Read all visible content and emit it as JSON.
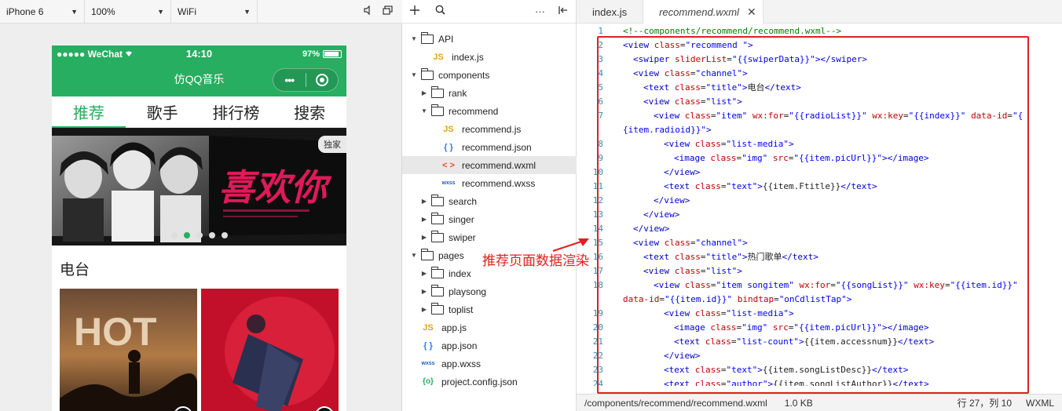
{
  "simulator": {
    "toolbar": {
      "device": "iPhone 6",
      "zoom": "100%",
      "network": "WiFi"
    },
    "status": {
      "carrier": "●●●●● WeChat",
      "time": "14:10",
      "battery": "97%"
    },
    "nav_title": "仿QQ音乐",
    "capsule_dots": "•••",
    "tabs": [
      "推荐",
      "歌手",
      "排行榜",
      "搜索"
    ],
    "banner": {
      "badge": "独家",
      "artwork_text": "喜欢你",
      "dots_count": 6,
      "active_dot": 1
    },
    "section_title": "电台",
    "radio_art_text": "HOT"
  },
  "explorer": {
    "items": [
      {
        "label": "API",
        "kind": "folder",
        "open": true,
        "depth": 0
      },
      {
        "label": "index.js",
        "kind": "js",
        "depth": 1
      },
      {
        "label": "components",
        "kind": "folder",
        "open": true,
        "depth": 0
      },
      {
        "label": "rank",
        "kind": "folder",
        "open": false,
        "depth": 1
      },
      {
        "label": "recommend",
        "kind": "folder",
        "open": true,
        "depth": 1
      },
      {
        "label": "recommend.js",
        "kind": "js",
        "depth": 2
      },
      {
        "label": "recommend.json",
        "kind": "json",
        "depth": 2
      },
      {
        "label": "recommend.wxml",
        "kind": "wxml",
        "depth": 2,
        "selected": true
      },
      {
        "label": "recommend.wxss",
        "kind": "wxss",
        "depth": 2
      },
      {
        "label": "search",
        "kind": "folder",
        "open": false,
        "depth": 1
      },
      {
        "label": "singer",
        "kind": "folder",
        "open": false,
        "depth": 1
      },
      {
        "label": "swiper",
        "kind": "folder",
        "open": false,
        "depth": 1
      },
      {
        "label": "pages",
        "kind": "folder",
        "open": true,
        "depth": 0
      },
      {
        "label": "index",
        "kind": "folder",
        "open": false,
        "depth": 1
      },
      {
        "label": "playsong",
        "kind": "folder",
        "open": false,
        "depth": 1
      },
      {
        "label": "toplist",
        "kind": "folder",
        "open": false,
        "depth": 1
      },
      {
        "label": "app.js",
        "kind": "js",
        "depth": 0
      },
      {
        "label": "app.json",
        "kind": "json",
        "depth": 0
      },
      {
        "label": "app.wxss",
        "kind": "wxss",
        "depth": 0
      },
      {
        "label": "project.config.json",
        "kind": "cfg",
        "depth": 0
      }
    ]
  },
  "editor": {
    "tabs": [
      {
        "label": "index.js",
        "active": false
      },
      {
        "label": "recommend.wxml",
        "active": true
      }
    ],
    "lines": [
      {
        "n": "1",
        "indent": 0,
        "parts": [
          [
            "com",
            "<!--components/recommend/recommend.wxml-->"
          ]
        ]
      },
      {
        "n": "2",
        "indent": 0,
        "parts": [
          [
            "tag",
            "<view "
          ],
          [
            "attr",
            "class"
          ],
          [
            "txt",
            "="
          ],
          [
            "val",
            "\"recommend \""
          ],
          [
            "tag",
            ">"
          ]
        ]
      },
      {
        "n": "3",
        "indent": 1,
        "parts": [
          [
            "tag",
            "<swiper "
          ],
          [
            "attr",
            "sliderList"
          ],
          [
            "txt",
            "="
          ],
          [
            "val",
            "\"{{swiperData}}\""
          ],
          [
            "tag",
            "></swiper>"
          ]
        ]
      },
      {
        "n": "4",
        "indent": 1,
        "parts": [
          [
            "tag",
            "<view "
          ],
          [
            "attr",
            "class"
          ],
          [
            "txt",
            "="
          ],
          [
            "val",
            "\"channel\""
          ],
          [
            "tag",
            ">"
          ]
        ]
      },
      {
        "n": "5",
        "indent": 2,
        "parts": [
          [
            "tag",
            "<text "
          ],
          [
            "attr",
            "class"
          ],
          [
            "txt",
            "="
          ],
          [
            "val",
            "\"title\""
          ],
          [
            "tag",
            ">"
          ],
          [
            "txt",
            "电台"
          ],
          [
            "tag",
            "</text>"
          ]
        ]
      },
      {
        "n": "6",
        "indent": 2,
        "parts": [
          [
            "tag",
            "<view "
          ],
          [
            "attr",
            "class"
          ],
          [
            "txt",
            "="
          ],
          [
            "val",
            "\"list\""
          ],
          [
            "tag",
            ">"
          ]
        ]
      },
      {
        "n": "7",
        "indent": 3,
        "parts": [
          [
            "tag",
            "<view "
          ],
          [
            "attr",
            "class"
          ],
          [
            "txt",
            "="
          ],
          [
            "val",
            "\"item\" "
          ],
          [
            "attr",
            "wx:for"
          ],
          [
            "txt",
            "="
          ],
          [
            "val",
            "\"{{radioList}}\" "
          ],
          [
            "attr",
            "wx:key"
          ],
          [
            "txt",
            "="
          ],
          [
            "val",
            "\"{{index}}\" "
          ],
          [
            "attr",
            "data-id"
          ],
          [
            "txt",
            "="
          ],
          [
            "val",
            "\"{"
          ]
        ]
      },
      {
        "n": "",
        "indent": 0,
        "parts": [
          [
            "val",
            "{item.radioid}}\""
          ],
          [
            "tag",
            ">"
          ]
        ]
      },
      {
        "n": "8",
        "indent": 4,
        "parts": [
          [
            "tag",
            "<view "
          ],
          [
            "attr",
            "class"
          ],
          [
            "txt",
            "="
          ],
          [
            "val",
            "\"list-media\""
          ],
          [
            "tag",
            ">"
          ]
        ]
      },
      {
        "n": "9",
        "indent": 5,
        "parts": [
          [
            "tag",
            "<image "
          ],
          [
            "attr",
            "class"
          ],
          [
            "txt",
            "="
          ],
          [
            "val",
            "\"img\" "
          ],
          [
            "attr",
            "src"
          ],
          [
            "txt",
            "="
          ],
          [
            "val",
            "\"{{item.picUrl}}\""
          ],
          [
            "tag",
            "></image>"
          ]
        ]
      },
      {
        "n": "10",
        "indent": 4,
        "parts": [
          [
            "tag",
            "</view>"
          ]
        ]
      },
      {
        "n": "11",
        "indent": 4,
        "parts": [
          [
            "tag",
            "<text "
          ],
          [
            "attr",
            "class"
          ],
          [
            "txt",
            "="
          ],
          [
            "val",
            "\"text\""
          ],
          [
            "tag",
            ">"
          ],
          [
            "txt",
            "{{item.Ftitle}}"
          ],
          [
            "tag",
            "</text>"
          ]
        ]
      },
      {
        "n": "12",
        "indent": 3,
        "parts": [
          [
            "tag",
            "</view>"
          ]
        ]
      },
      {
        "n": "13",
        "indent": 2,
        "parts": [
          [
            "tag",
            "</view>"
          ]
        ]
      },
      {
        "n": "14",
        "indent": 1,
        "parts": [
          [
            "tag",
            "</view>"
          ]
        ]
      },
      {
        "n": "15",
        "indent": 1,
        "parts": [
          [
            "tag",
            "<view "
          ],
          [
            "attr",
            "class"
          ],
          [
            "txt",
            "="
          ],
          [
            "val",
            "\"channel\""
          ],
          [
            "tag",
            ">"
          ]
        ]
      },
      {
        "n": "16",
        "indent": 2,
        "parts": [
          [
            "tag",
            "<text "
          ],
          [
            "attr",
            "class"
          ],
          [
            "txt",
            "="
          ],
          [
            "val",
            "\"title\""
          ],
          [
            "tag",
            ">"
          ],
          [
            "txt",
            "热门歌单"
          ],
          [
            "tag",
            "</text>"
          ]
        ]
      },
      {
        "n": "17",
        "indent": 2,
        "parts": [
          [
            "tag",
            "<view "
          ],
          [
            "attr",
            "class"
          ],
          [
            "txt",
            "="
          ],
          [
            "val",
            "\"list\""
          ],
          [
            "tag",
            ">"
          ]
        ]
      },
      {
        "n": "18",
        "indent": 3,
        "parts": [
          [
            "tag",
            "<view "
          ],
          [
            "attr",
            "class"
          ],
          [
            "txt",
            "="
          ],
          [
            "val",
            "\"item songitem\" "
          ],
          [
            "attr",
            "wx:for"
          ],
          [
            "txt",
            "="
          ],
          [
            "val",
            "\"{{songList}}\" "
          ],
          [
            "attr",
            "wx:key"
          ],
          [
            "txt",
            "="
          ],
          [
            "val",
            "\"{{item.id}}\""
          ]
        ]
      },
      {
        "n": "",
        "indent": 0,
        "parts": [
          [
            "attr",
            "data-id"
          ],
          [
            "txt",
            "="
          ],
          [
            "val",
            "\"{{item.id}}\" "
          ],
          [
            "attr",
            "bindtap"
          ],
          [
            "txt",
            "="
          ],
          [
            "val",
            "\"onCdlistTap\""
          ],
          [
            "tag",
            ">"
          ]
        ]
      },
      {
        "n": "19",
        "indent": 4,
        "parts": [
          [
            "tag",
            "<view "
          ],
          [
            "attr",
            "class"
          ],
          [
            "txt",
            "="
          ],
          [
            "val",
            "\"list-media\""
          ],
          [
            "tag",
            ">"
          ]
        ]
      },
      {
        "n": "20",
        "indent": 5,
        "parts": [
          [
            "tag",
            "<image "
          ],
          [
            "attr",
            "class"
          ],
          [
            "txt",
            "="
          ],
          [
            "val",
            "\"img\" "
          ],
          [
            "attr",
            "src"
          ],
          [
            "txt",
            "="
          ],
          [
            "val",
            "\"{{item.picUrl}}\""
          ],
          [
            "tag",
            "></image>"
          ]
        ]
      },
      {
        "n": "21",
        "indent": 5,
        "parts": [
          [
            "tag",
            "<text "
          ],
          [
            "attr",
            "class"
          ],
          [
            "txt",
            "="
          ],
          [
            "val",
            "\"list-count\""
          ],
          [
            "tag",
            ">"
          ],
          [
            "txt",
            "{{item.accessnum}}"
          ],
          [
            "tag",
            "</text>"
          ]
        ]
      },
      {
        "n": "22",
        "indent": 4,
        "parts": [
          [
            "tag",
            "</view>"
          ]
        ]
      },
      {
        "n": "23",
        "indent": 4,
        "parts": [
          [
            "tag",
            "<text "
          ],
          [
            "attr",
            "class"
          ],
          [
            "txt",
            "="
          ],
          [
            "val",
            "\"text\""
          ],
          [
            "tag",
            ">"
          ],
          [
            "txt",
            "{{item.songListDesc}}"
          ],
          [
            "tag",
            "</text>"
          ]
        ]
      },
      {
        "n": "24",
        "indent": 4,
        "parts": [
          [
            "tag",
            "<text "
          ],
          [
            "attr",
            "class"
          ],
          [
            "txt",
            "="
          ],
          [
            "val",
            "\"author\""
          ],
          [
            "tag",
            ">"
          ],
          [
            "txt",
            "{{item.songListAuthor}}"
          ],
          [
            "tag",
            "</text>"
          ]
        ]
      }
    ],
    "status": {
      "path": "/components/recommend/recommend.wxml",
      "size": "1.0 KB",
      "position": "行 27，列 10",
      "language": "WXML"
    }
  },
  "annotation": "推荐页面数据渲染",
  "colors": {
    "accent_green": "#27ae60",
    "highlight_red": "#e02020"
  },
  "icons": [
    "chevron-down-icon",
    "speaker-icon",
    "window-icon",
    "plus-icon",
    "search-icon",
    "more-icon",
    "collapse-icon",
    "close-icon",
    "folder-icon",
    "js-file-icon",
    "json-file-icon",
    "wxml-file-icon",
    "wxss-file-icon",
    "config-file-icon",
    "play-icon",
    "wifi-icon",
    "battery-icon"
  ]
}
